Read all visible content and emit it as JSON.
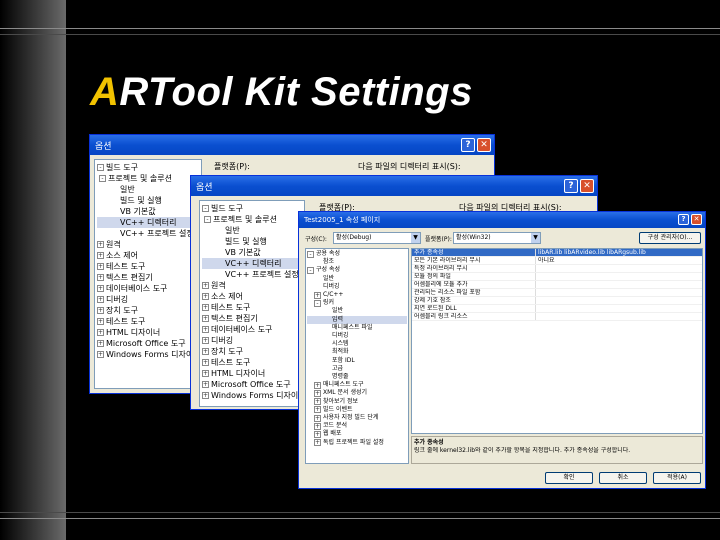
{
  "slide": {
    "title_accent": "A",
    "title_rest": "RTool Kit Settings"
  },
  "dialog_back": {
    "title": "옵션",
    "right_label": "플랫폼(P):",
    "right_label2": "다음 파일의 디렉터리 표시(S):",
    "tree": [
      {
        "label": "빌드 도구",
        "exp": "-"
      },
      {
        "label": "프로젝트 및 솔루션",
        "exp": "-"
      },
      {
        "label": "일반",
        "exp": ""
      },
      {
        "label": "빌드 및 실행",
        "exp": ""
      },
      {
        "label": "VB 기본값",
        "exp": ""
      },
      {
        "label": "VC++ 디렉터리",
        "exp": "",
        "sel": true
      },
      {
        "label": "VC++ 프로젝트 설정",
        "exp": ""
      },
      {
        "label": "원격",
        "exp": "+"
      },
      {
        "label": "소스 제어",
        "exp": "+"
      },
      {
        "label": "테스트 도구",
        "exp": "+"
      },
      {
        "label": "텍스트 편집기",
        "exp": "+"
      },
      {
        "label": "데이터베이스 도구",
        "exp": "+"
      },
      {
        "label": "디버깅",
        "exp": "+"
      },
      {
        "label": "장치 도구",
        "exp": "+"
      },
      {
        "label": "테스트 도구",
        "exp": "+"
      },
      {
        "label": "HTML 디자이너",
        "exp": "+"
      },
      {
        "label": "Microsoft Office 도구",
        "exp": "+"
      },
      {
        "label": "Windows Forms 디자이너",
        "exp": "+"
      }
    ]
  },
  "dialog_mid": {
    "title": "옵션",
    "right_label": "플랫폼(P):",
    "right_label2": "다음 파일의 디렉터리 표시(S):",
    "tree": [
      {
        "label": "빌드 도구",
        "exp": "-"
      },
      {
        "label": "프로젝트 및 솔루션",
        "exp": "-"
      },
      {
        "label": "일반",
        "exp": ""
      },
      {
        "label": "빌드 및 실행",
        "exp": ""
      },
      {
        "label": "VB 기본값",
        "exp": ""
      },
      {
        "label": "VC++ 디렉터리",
        "exp": "",
        "sel": true
      },
      {
        "label": "VC++ 프로젝트 설정",
        "exp": ""
      },
      {
        "label": "원격",
        "exp": "+"
      },
      {
        "label": "소스 제어",
        "exp": "+"
      },
      {
        "label": "테스트 도구",
        "exp": "+"
      },
      {
        "label": "텍스트 편집기",
        "exp": "+"
      },
      {
        "label": "데이터베이스 도구",
        "exp": "+"
      },
      {
        "label": "디버깅",
        "exp": "+"
      },
      {
        "label": "장치 도구",
        "exp": "+"
      },
      {
        "label": "테스트 도구",
        "exp": "+"
      },
      {
        "label": "HTML 디자이너",
        "exp": "+"
      },
      {
        "label": "Microsoft Office 도구",
        "exp": "+"
      },
      {
        "label": "Windows Forms 디자이너",
        "exp": "+"
      }
    ]
  },
  "dialog_front": {
    "title": "Test2005_1 속성 페이지",
    "config_label": "구성(C):",
    "config_value": "활성(Debug)",
    "platform_label": "플랫폼(P):",
    "platform_value": "활성(Win32)",
    "config_manager_button": "구성 관리자(O)...",
    "tree": [
      {
        "label": "공용 속성",
        "exp": "-"
      },
      {
        "label": "참조",
        "exp": ""
      },
      {
        "label": "구성 속성",
        "exp": "-"
      },
      {
        "label": "일반",
        "exp": ""
      },
      {
        "label": "디버깅",
        "exp": ""
      },
      {
        "label": "C/C++",
        "exp": "+"
      },
      {
        "label": "링커",
        "exp": "-"
      },
      {
        "label": "일반",
        "exp": ""
      },
      {
        "label": "입력",
        "exp": "",
        "sel": true
      },
      {
        "label": "매니페스트 파일",
        "exp": ""
      },
      {
        "label": "디버깅",
        "exp": ""
      },
      {
        "label": "시스템",
        "exp": ""
      },
      {
        "label": "최적화",
        "exp": ""
      },
      {
        "label": "포함 IDL",
        "exp": ""
      },
      {
        "label": "고급",
        "exp": ""
      },
      {
        "label": "명령줄",
        "exp": ""
      },
      {
        "label": "매니페스트 도구",
        "exp": "+"
      },
      {
        "label": "XML 문서 생성기",
        "exp": "+"
      },
      {
        "label": "찾아보기 정보",
        "exp": "+"
      },
      {
        "label": "빌드 이벤트",
        "exp": "+"
      },
      {
        "label": "사용자 지정 빌드 단계",
        "exp": "+"
      },
      {
        "label": "코드 분석",
        "exp": "+"
      },
      {
        "label": "웹 배포",
        "exp": "+"
      },
      {
        "label": "독립 프로젝트 파일 설정",
        "exp": "+"
      }
    ],
    "properties": [
      {
        "name": "추가 종속성",
        "value": "libAR.lib libARvideo.lib libARgsub.lib",
        "selected": true
      },
      {
        "name": "모든 기본 라이브러리 무시",
        "value": "아니요"
      },
      {
        "name": "특정 라이브러리 무시",
        "value": ""
      },
      {
        "name": "모듈 정의 파일",
        "value": ""
      },
      {
        "name": "어셈블리에 모듈 추가",
        "value": ""
      },
      {
        "name": "관리되는 리소스 파일 포함",
        "value": ""
      },
      {
        "name": "강제 기호 참조",
        "value": ""
      },
      {
        "name": "지연 로드된 DLL",
        "value": ""
      },
      {
        "name": "어셈블리 링크 리소스",
        "value": ""
      }
    ],
    "desc_title": "추가 종속성",
    "desc_text": "링크 줄에 kernel32.lib와 같이 추가할 항목을 지정합니다. 추가 종속성을 구성합니다.",
    "ok_button": "확인",
    "cancel_button": "취소",
    "apply_button": "적용(A)"
  }
}
